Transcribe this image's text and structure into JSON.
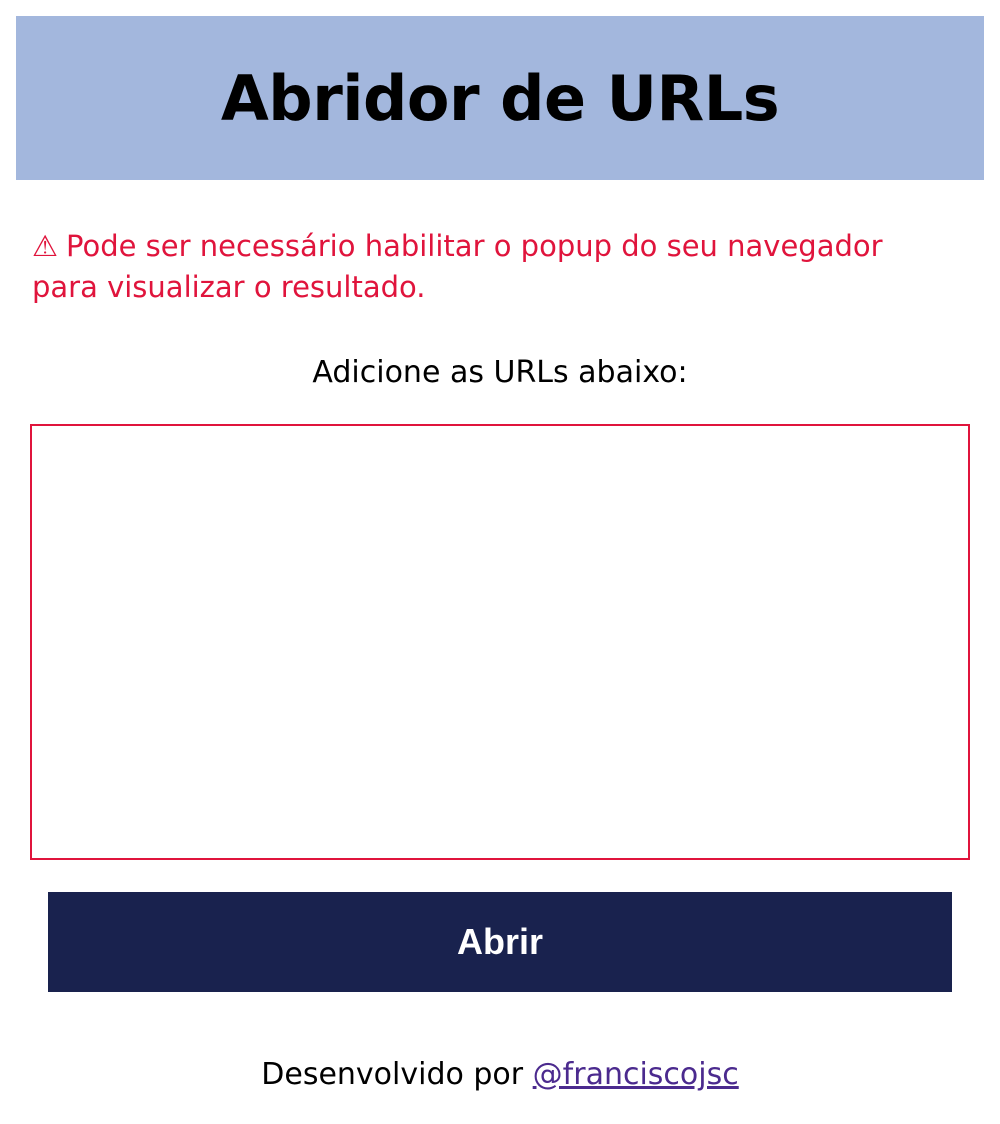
{
  "header": {
    "title": "Abridor de URLs"
  },
  "warning": {
    "icon": "warning-icon",
    "icon_glyph": "⚠",
    "text": "Pode ser necessário habilitar o popup do seu navegador para visualizar o resultado."
  },
  "form": {
    "prompt": "Adicione as URLs abaixo:",
    "urls_value": "",
    "open_label": "Abrir"
  },
  "footer": {
    "prefix": "Desenvolvido por ",
    "author_link": "@franciscojsc"
  },
  "colors": {
    "header_bg": "#a3b7dd",
    "warning": "#e0143c",
    "button_bg": "#19224e",
    "link": "#4b2a8e"
  }
}
